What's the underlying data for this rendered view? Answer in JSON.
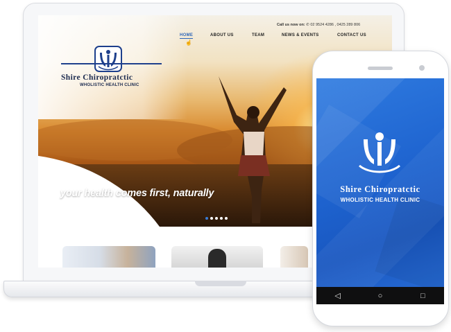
{
  "website": {
    "call_us": "Call us now on:",
    "phone_numbers": "02 9524 4286 , 0425 289 806",
    "nav": [
      {
        "label": "HOME",
        "active": true
      },
      {
        "label": "ABOUT US"
      },
      {
        "label": "TEAM"
      },
      {
        "label": "NEWS & EVENTS"
      },
      {
        "label": "CONTACT US"
      }
    ],
    "logo_title": "Shire Chiropratctic",
    "logo_subtitle": "WHOLISTIC HEALTH CLINIC",
    "tagline": "your health comes first, naturally",
    "slider_dots": 5,
    "slider_active": 0
  },
  "app": {
    "title": "Shire Chiropratctic",
    "subtitle": "WHOLISTIC HEALTH CLINIC",
    "nav_buttons": [
      "back-icon",
      "home-icon",
      "recents-icon"
    ]
  },
  "colors": {
    "brand_blue": "#1e63cf",
    "logo_navy": "#1b2a4f",
    "nav_active": "#2b64b8"
  }
}
